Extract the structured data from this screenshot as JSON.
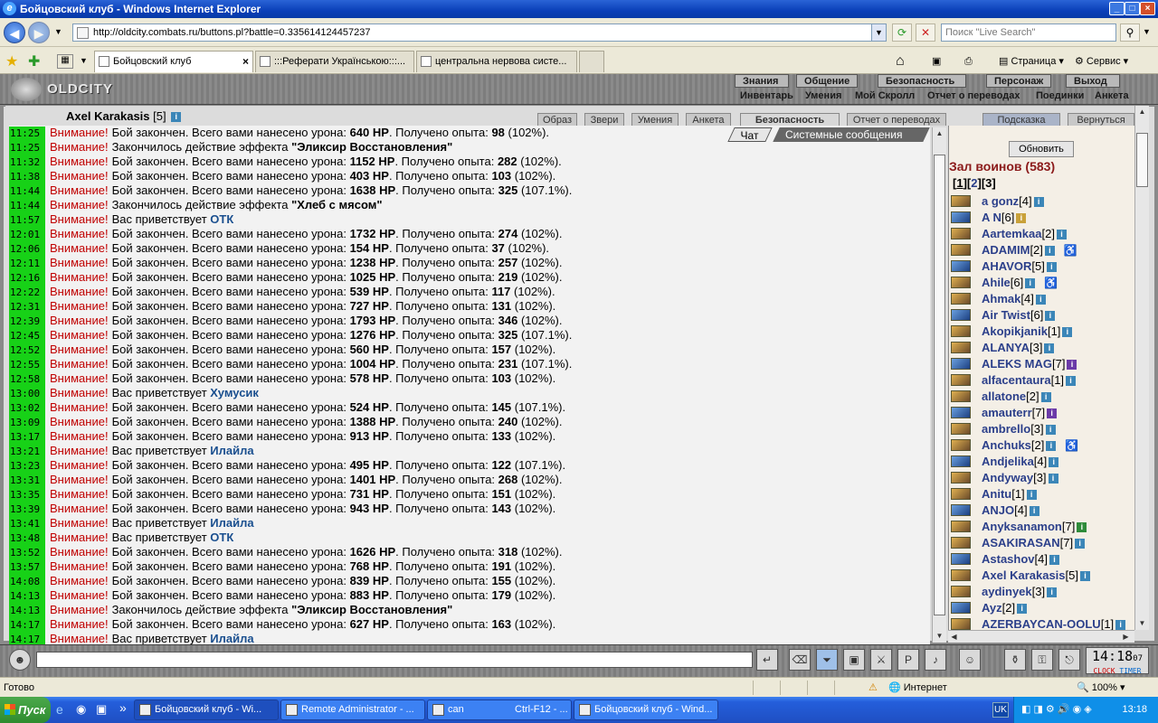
{
  "window": {
    "title": "Бойцовский клуб - Windows Internet Explorer",
    "min": "_",
    "max": "□",
    "close": "×"
  },
  "address": {
    "url": "http://oldcity.combats.ru/buttons.pl?battle=0.335614124457237",
    "search_placeholder": "Поиск \"Live Search\""
  },
  "tabs": [
    {
      "label": "Бойцовский клуб",
      "close": "×"
    },
    {
      "label": ":::Реферати Українською:::..."
    },
    {
      "label": "центральна нервова систе..."
    }
  ],
  "toolbar": {
    "page": "Страница",
    "service": "Сервис"
  },
  "game": {
    "logo": "OLDCITY",
    "menu_top": [
      "Знания",
      "Общение",
      "Безопасность",
      "Персонаж",
      "Выход"
    ],
    "menu_sub": [
      "Инвентарь",
      "Умения",
      "Мой Скролл",
      "Отчет о переводах",
      "Поединки",
      "Анкета"
    ],
    "char_name": "Axel Karakasis",
    "char_level": "[5]",
    "panel_tabs": [
      "Образ",
      "Звери",
      "Умения",
      "Анкета",
      "Безопасность",
      "Отчет о переводах",
      "Подсказка",
      "Вернуться"
    ]
  },
  "chat_tabs": [
    "Чат",
    "Системные сообщения"
  ],
  "chat": [
    {
      "time": "11:25",
      "text": "Бой закончен. Всего вами нанесено урона: ",
      "hp": "640 HP",
      "mid": ". Получено опыта: ",
      "exp": "98",
      "pct": " (102%)."
    },
    {
      "time": "11:25",
      "text": "Закончилось действие эффекта ",
      "item": "\"Эликсир Восстановления\""
    },
    {
      "time": "11:32",
      "text": "Бой закончен. Всего вами нанесено урона: ",
      "hp": "1152 HP",
      "mid": ". Получено опыта: ",
      "exp": "282",
      "pct": " (102%)."
    },
    {
      "time": "11:38",
      "text": "Бой закончен. Всего вами нанесено урона: ",
      "hp": "403 HP",
      "mid": ". Получено опыта: ",
      "exp": "103",
      "pct": " (102%)."
    },
    {
      "time": "11:44",
      "text": "Бой закончен. Всего вами нанесено урона: ",
      "hp": "1638 HP",
      "mid": ". Получено опыта: ",
      "exp": "325",
      "pct": " (107.1%)."
    },
    {
      "time": "11:44",
      "text": "Закончилось действие эффекта ",
      "item": "\"Хлеб с мясом\""
    },
    {
      "time": "11:57",
      "text": "Вас приветствует ",
      "who": "ОТК"
    },
    {
      "time": "12:01",
      "text": "Бой закончен. Всего вами нанесено урона: ",
      "hp": "1732 HP",
      "mid": ". Получено опыта: ",
      "exp": "274",
      "pct": " (102%)."
    },
    {
      "time": "12:06",
      "text": "Бой закончен. Всего вами нанесено урона: ",
      "hp": "154 HP",
      "mid": ". Получено опыта: ",
      "exp": "37",
      "pct": " (102%)."
    },
    {
      "time": "12:11",
      "text": "Бой закончен. Всего вами нанесено урона: ",
      "hp": "1238 HP",
      "mid": ". Получено опыта: ",
      "exp": "257",
      "pct": " (102%)."
    },
    {
      "time": "12:16",
      "text": "Бой закончен. Всего вами нанесено урона: ",
      "hp": "1025 HP",
      "mid": ". Получено опыта: ",
      "exp": "219",
      "pct": " (102%)."
    },
    {
      "time": "12:22",
      "text": "Бой закончен. Всего вами нанесено урона: ",
      "hp": "539 HP",
      "mid": ". Получено опыта: ",
      "exp": "117",
      "pct": " (102%)."
    },
    {
      "time": "12:31",
      "text": "Бой закончен. Всего вами нанесено урона: ",
      "hp": "727 HP",
      "mid": ". Получено опыта: ",
      "exp": "131",
      "pct": " (102%)."
    },
    {
      "time": "12:39",
      "text": "Бой закончен. Всего вами нанесено урона: ",
      "hp": "1793 HP",
      "mid": ". Получено опыта: ",
      "exp": "346",
      "pct": " (102%)."
    },
    {
      "time": "12:45",
      "text": "Бой закончен. Всего вами нанесено урона: ",
      "hp": "1276 HP",
      "mid": ". Получено опыта: ",
      "exp": "325",
      "pct": " (107.1%)."
    },
    {
      "time": "12:52",
      "text": "Бой закончен. Всего вами нанесено урона: ",
      "hp": "560 HP",
      "mid": ". Получено опыта: ",
      "exp": "157",
      "pct": " (102%)."
    },
    {
      "time": "12:55",
      "text": "Бой закончен. Всего вами нанесено урона: ",
      "hp": "1004 HP",
      "mid": ". Получено опыта: ",
      "exp": "231",
      "pct": " (107.1%)."
    },
    {
      "time": "12:58",
      "text": "Бой закончен. Всего вами нанесено урона: ",
      "hp": "578 HP",
      "mid": ". Получено опыта: ",
      "exp": "103",
      "pct": " (102%)."
    },
    {
      "time": "13:00",
      "text": "Вас приветствует ",
      "who": "Хумусик"
    },
    {
      "time": "13:02",
      "text": "Бой закончен. Всего вами нанесено урона: ",
      "hp": "524 HP",
      "mid": ". Получено опыта: ",
      "exp": "145",
      "pct": " (107.1%)."
    },
    {
      "time": "13:09",
      "text": "Бой закончен. Всего вами нанесено урона: ",
      "hp": "1388 HP",
      "mid": ". Получено опыта: ",
      "exp": "240",
      "pct": " (102%)."
    },
    {
      "time": "13:17",
      "text": "Бой закончен. Всего вами нанесено урона: ",
      "hp": "913 HP",
      "mid": ". Получено опыта: ",
      "exp": "133",
      "pct": " (102%)."
    },
    {
      "time": "13:21",
      "text": "Вас приветствует ",
      "who": "Илайла"
    },
    {
      "time": "13:23",
      "text": "Бой закончен. Всего вами нанесено урона: ",
      "hp": "495 HP",
      "mid": ". Получено опыта: ",
      "exp": "122",
      "pct": " (107.1%)."
    },
    {
      "time": "13:31",
      "text": "Бой закончен. Всего вами нанесено урона: ",
      "hp": "1401 HP",
      "mid": ". Получено опыта: ",
      "exp": "268",
      "pct": " (102%)."
    },
    {
      "time": "13:35",
      "text": "Бой закончен. Всего вами нанесено урона: ",
      "hp": "731 HP",
      "mid": ". Получено опыта: ",
      "exp": "151",
      "pct": " (102%)."
    },
    {
      "time": "13:39",
      "text": "Бой закончен. Всего вами нанесено урона: ",
      "hp": "943 HP",
      "mid": ". Получено опыта: ",
      "exp": "143",
      "pct": " (102%)."
    },
    {
      "time": "13:41",
      "text": "Вас приветствует ",
      "who": "Илайла"
    },
    {
      "time": "13:48",
      "text": "Вас приветствует ",
      "who": "ОТК"
    },
    {
      "time": "13:52",
      "text": "Бой закончен. Всего вами нанесено урона: ",
      "hp": "1626 HP",
      "mid": ". Получено опыта: ",
      "exp": "318",
      "pct": " (102%)."
    },
    {
      "time": "13:57",
      "text": "Бой закончен. Всего вами нанесено урона: ",
      "hp": "768 HP",
      "mid": ". Получено опыта: ",
      "exp": "191",
      "pct": " (102%)."
    },
    {
      "time": "14:08",
      "text": "Бой закончен. Всего вами нанесено урона: ",
      "hp": "839 HP",
      "mid": ". Получено опыта: ",
      "exp": "155",
      "pct": " (102%)."
    },
    {
      "time": "14:13",
      "text": "Бой закончен. Всего вами нанесено урона: ",
      "hp": "883 HP",
      "mid": ". Получено опыта: ",
      "exp": "179",
      "pct": " (102%)."
    },
    {
      "time": "14:13",
      "text": "Закончилось действие эффекта ",
      "item": "\"Эликсир Восстановления\""
    },
    {
      "time": "14:17",
      "text": "Бой закончен. Всего вами нанесено урона: ",
      "hp": "627 HP",
      "mid": ". Получено опыта: ",
      "exp": "163",
      "pct": " (102%)."
    },
    {
      "time": "14:17",
      "text": "Вас приветствует ",
      "who": "Илайла"
    }
  ],
  "attention_label": "Внимание!",
  "sidebar": {
    "refresh": "Обновить",
    "hall": "Зал воинов (583)",
    "pages": [
      "1",
      "2",
      "3"
    ],
    "players": [
      {
        "name": "a gonz",
        "lvl": "[4]",
        "ic": "blue"
      },
      {
        "name": "A N",
        "lvl": "[6]",
        "ic": "yellow"
      },
      {
        "name": "Aartemkaa",
        "lvl": "[2]",
        "ic": "blue"
      },
      {
        "name": "ADAMIM",
        "lvl": "[2]",
        "ic": "blue",
        "wc": "♿"
      },
      {
        "name": "AHAVOR",
        "lvl": "[5]",
        "ic": "blue"
      },
      {
        "name": "Ahile",
        "lvl": "[6]",
        "ic": "blue",
        "wc": "♿"
      },
      {
        "name": "Ahmak",
        "lvl": "[4]",
        "ic": "blue"
      },
      {
        "name": "Air Twist",
        "lvl": "[6]",
        "ic": "blue"
      },
      {
        "name": "Akopikjanik",
        "lvl": "[1]",
        "ic": "blue"
      },
      {
        "name": "ALANYA",
        "lvl": "[3]",
        "ic": "blue"
      },
      {
        "name": "ALEKS MAG",
        "lvl": "[7]",
        "ic": "purple"
      },
      {
        "name": "alfacentaura",
        "lvl": "[1]",
        "ic": "blue"
      },
      {
        "name": "allatone",
        "lvl": "[2]",
        "ic": "blue"
      },
      {
        "name": "amauterr",
        "lvl": "[7]",
        "ic": "purple"
      },
      {
        "name": "ambrello",
        "lvl": "[3]",
        "ic": "blue"
      },
      {
        "name": "Anchuks",
        "lvl": "[2]",
        "ic": "blue",
        "wc": "♿"
      },
      {
        "name": "Andjelika",
        "lvl": "[4]",
        "ic": "blue"
      },
      {
        "name": "Andyway",
        "lvl": "[3]",
        "ic": "blue"
      },
      {
        "name": "Anitu",
        "lvl": "[1]",
        "ic": "blue"
      },
      {
        "name": "ANJO",
        "lvl": "[4]",
        "ic": "blue"
      },
      {
        "name": "Anyksanamon",
        "lvl": "[7]",
        "ic": "green"
      },
      {
        "name": "ASAKIRASAN",
        "lvl": "[7]",
        "ic": "blue"
      },
      {
        "name": "Astashov",
        "lvl": "[4]",
        "ic": "blue"
      },
      {
        "name": "Axel Karakasis",
        "lvl": "[5]",
        "ic": "blue"
      },
      {
        "name": "aydinyek",
        "lvl": "[3]",
        "ic": "blue"
      },
      {
        "name": "Ayz",
        "lvl": "[2]",
        "ic": "blue"
      },
      {
        "name": "AZERBAYCAN-OOLU",
        "lvl": "[1]",
        "ic": "blue"
      }
    ]
  },
  "clock": {
    "time": "14:18",
    "sec": "07",
    "label1": "CLOCK",
    "label2": "TIMER"
  },
  "status": {
    "left": "Готово",
    "zone": "Интернет",
    "zoom": "100%"
  },
  "taskbar": {
    "start": "Пуск",
    "tasks": [
      "Бойцовский клуб - Wi...",
      "Remote Administrator - ...",
      "can",
      "Ctrl-F12 - ...",
      "Бойцовский клуб - Wind..."
    ],
    "lang": "UK",
    "time": "13:18"
  }
}
